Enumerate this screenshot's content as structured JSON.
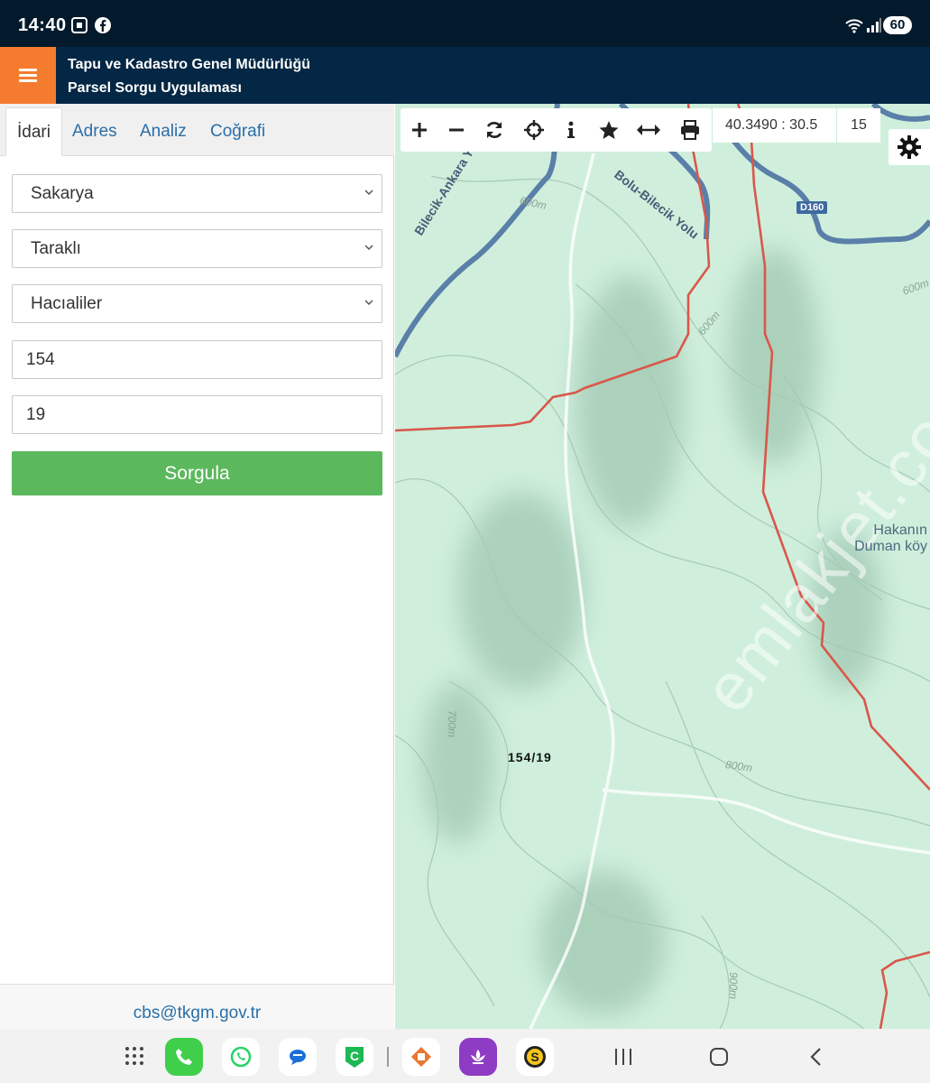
{
  "status_bar": {
    "time": "14:40",
    "battery": "60"
  },
  "header": {
    "title_line1": "Tapu ve Kadastro Genel Müdürlüğü",
    "title_line2": "Parsel Sorgu Uygulaması"
  },
  "tabs": [
    {
      "label": "İdari",
      "active": true
    },
    {
      "label": "Adres",
      "active": false
    },
    {
      "label": "Analiz",
      "active": false
    },
    {
      "label": "Coğrafi",
      "active": false
    }
  ],
  "form": {
    "province": "Sakarya",
    "district": "Taraklı",
    "neighborhood": "Hacıaliler",
    "block": "154",
    "parcel": "19",
    "submit_label": "Sorgula"
  },
  "footer": {
    "email": "cbs@tkgm.gov.tr"
  },
  "map": {
    "coordinates": "40.3490 : 30.5",
    "zoom_level": "15",
    "parcel_label": "154/19",
    "road_labels": [
      "Bilecik-Ankara Yolu",
      "Bolu-Bilecik Yolu",
      "D160"
    ],
    "contour_labels": [
      "600m",
      "600m",
      "600m",
      "700m",
      "800m",
      "900m"
    ],
    "place_name_line1": "Hakanın",
    "place_name_line2": "Duman köy",
    "watermark": "emlakjet.com",
    "tools": [
      "plus-icon",
      "minus-icon",
      "refresh-icon",
      "locate-icon",
      "info-icon",
      "star-icon",
      "measure-icon",
      "print-icon"
    ]
  },
  "colors": {
    "accent_orange": "#f57c2f",
    "header_navy": "#032744",
    "query_green": "#5cb85c",
    "map_bg": "#cfefdc",
    "boundary_red": "#d9574a",
    "road_blue": "#5a7fa8"
  }
}
